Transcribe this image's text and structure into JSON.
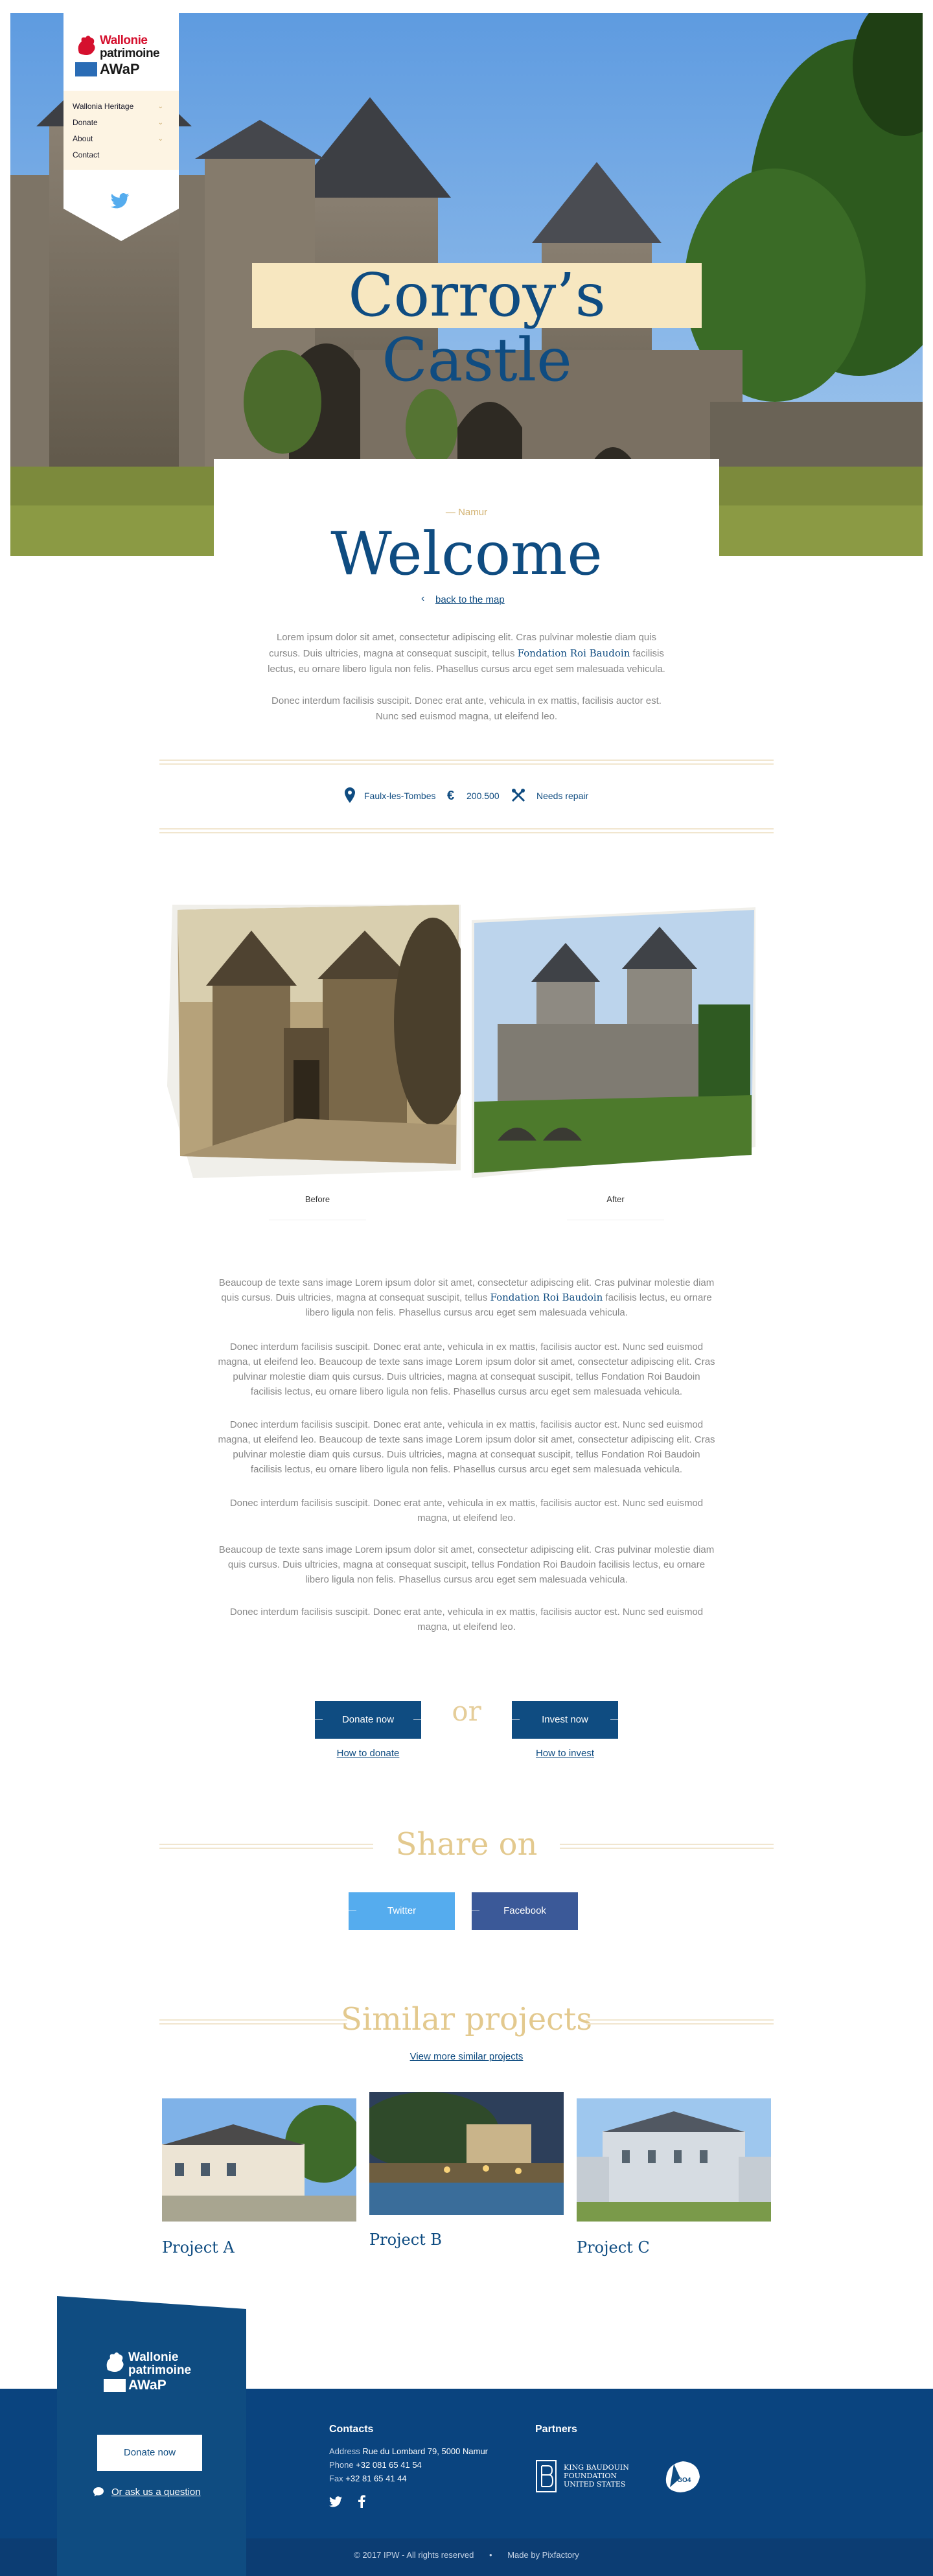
{
  "brand": {
    "line1": "Wallonie",
    "line2": "patrimoine",
    "line3": "AWaP",
    "accent": "#0f4c81",
    "gold": "#e3c98e",
    "red": "#d5102e"
  },
  "nav": {
    "items": [
      {
        "label": "Wallonia Heritage",
        "icon": "chevron-down-icon"
      },
      {
        "label": "Donate",
        "icon": "chevron-down-icon"
      },
      {
        "label": "About",
        "icon": "chevron-down-icon"
      },
      {
        "label": "Contact",
        "icon": ""
      }
    ],
    "social_icon": "twitter-icon"
  },
  "hero": {
    "title": "Corroy’s Castle"
  },
  "welcome": {
    "region": "— Namur",
    "heading": "Welcome",
    "back_link": "back to the map",
    "intro_p1_a": "Lorem ipsum dolor sit amet, consectetur adipiscing elit. Cras pulvinar molestie diam quis cursus. Duis ultricies, magna at consequat suscipit, tellus ",
    "intro_p1_hl": "Fondation Roi Baudoin",
    "intro_p1_b": " facilisis lectus, eu ornare libero ligula non felis. Phasellus cursus arcu eget sem malesuada vehicula.",
    "intro_p2": "Donec interdum facilisis suscipit. Donec erat ante, vehicula in ex mattis, facilisis auctor est. Nunc sed euismod magna, ut eleifend leo."
  },
  "info": {
    "location": "Faulx-les-Tombes",
    "amount": "200.500",
    "status": "Needs repair"
  },
  "gallery": {
    "before_label": "Before",
    "after_label": "After"
  },
  "body": {
    "p1_a": "Beaucoup de texte sans image Lorem ipsum dolor sit amet, consectetur adipiscing elit. Cras pulvinar molestie diam quis cursus. Duis ultricies, magna at consequat suscipit, tellus ",
    "p1_hl": "Fondation Roi Baudoin",
    "p1_b": " facilisis lectus, eu ornare libero ligula non felis. Phasellus cursus arcu eget sem malesuada vehicula.",
    "p2": "Donec interdum facilisis suscipit. Donec erat ante, vehicula in ex mattis, facilisis auctor est. Nunc sed euismod magna, ut eleifend leo. Beaucoup de texte sans image Lorem ipsum dolor sit amet, consectetur adipiscing elit. Cras pulvinar molestie diam quis cursus. Duis ultricies, magna at consequat suscipit, tellus Fondation Roi Baudoin facilisis lectus, eu ornare libero ligula non felis. Phasellus cursus arcu eget sem malesuada vehicula.",
    "p3": "Donec interdum facilisis suscipit. Donec erat ante, vehicula in ex mattis, facilisis auctor est. Nunc sed euismod magna, ut eleifend leo. Beaucoup de texte sans image Lorem ipsum dolor sit amet, consectetur adipiscing elit. Cras pulvinar molestie diam quis cursus. Duis ultricies, magna at consequat suscipit, tellus Fondation Roi Baudoin facilisis lectus, eu ornare libero ligula non felis. Phasellus cursus arcu eget sem malesuada vehicula.",
    "p4": "Donec interdum facilisis suscipit. Donec erat ante, vehicula in ex mattis, facilisis auctor est. Nunc sed euismod magna, ut eleifend leo.",
    "p5": "Beaucoup de texte sans image Lorem ipsum dolor sit amet, consectetur adipiscing elit. Cras pulvinar molestie diam quis cursus. Duis ultricies, magna at consequat suscipit, tellus Fondation Roi Baudoin facilisis lectus, eu ornare libero ligula non felis. Phasellus cursus arcu eget sem malesuada vehicula.",
    "p6": "Donec interdum facilisis suscipit. Donec erat ante, vehicula in ex mattis, facilisis auctor est. Nunc sed euismod magna, ut eleifend leo."
  },
  "cta": {
    "donate_label": "Donate now",
    "or_word": "or",
    "invest_label": "Invest now",
    "how_donate": "How to donate",
    "how_invest": "How to invest"
  },
  "share": {
    "heading": "Share on",
    "twitter_label": "Twitter",
    "facebook_label": "Facebook",
    "twitter_color": "#55acee",
    "facebook_color": "#3b5998"
  },
  "similar": {
    "heading": "Similar projects",
    "view_more": "View more similar projects",
    "projects": [
      {
        "name": "Project A"
      },
      {
        "name": "Project B"
      },
      {
        "name": "Project C"
      }
    ]
  },
  "footer": {
    "donate_label": "Donate now",
    "ask_link": "Or ask us a question",
    "contacts_heading": "Contacts",
    "address_label": "Address",
    "address_value": "Rue du Lombard 79, 5000 Namur",
    "phone_label": "Phone",
    "phone_value": "+32 081 65 41 54",
    "fax_label": "Fax",
    "fax_value": "+32 81 65 41 44",
    "partners_heading": "Partners",
    "partner1_line1": "KING BAUDOUIN",
    "partner1_line2": "FOUNDATION",
    "partner1_line3": "UNITED STATES",
    "partner2_name": "DGO4",
    "copyright": "© 2017 IPW - All rights reserved",
    "made_by": "Made by Pixfactory"
  }
}
